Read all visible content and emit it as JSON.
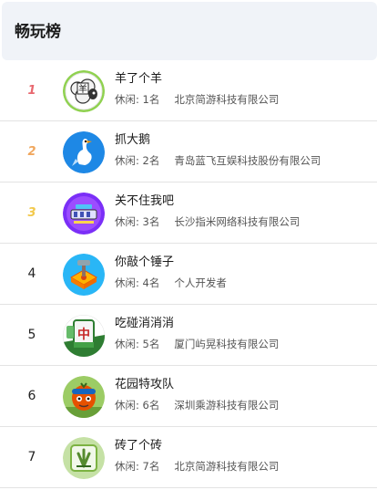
{
  "header": {
    "title": "畅玩榜"
  },
  "items": [
    {
      "rank": "1",
      "name": "羊了个羊",
      "status": "休闲: 1名",
      "company": "北京简游科技有限公司",
      "icon": "sheep-game-icon"
    },
    {
      "rank": "2",
      "name": "抓大鹅",
      "status": "休闲: 2名",
      "company": "青岛蓝飞互娱科技股份有限公司",
      "icon": "goose-game-icon"
    },
    {
      "rank": "3",
      "name": "关不住我吧",
      "status": "休闲: 3名",
      "company": "长沙指米网络科技有限公司",
      "icon": "escape-game-icon"
    },
    {
      "rank": "4",
      "name": "你敲个锤子",
      "status": "休闲: 4名",
      "company": "个人开发者",
      "icon": "hammer-game-icon"
    },
    {
      "rank": "5",
      "name": "吃碰消消消",
      "status": "休闲: 5名",
      "company": "厦门屿晃科技有限公司",
      "icon": "mahjong-game-icon"
    },
    {
      "rank": "6",
      "name": "花园特攻队",
      "status": "休闲: 6名",
      "company": "深圳乘游科技有限公司",
      "icon": "garden-game-icon"
    },
    {
      "rank": "7",
      "name": "砖了个砖",
      "status": "休闲: 7名",
      "company": "北京简游科技有限公司",
      "icon": "tile-game-icon"
    }
  ]
}
